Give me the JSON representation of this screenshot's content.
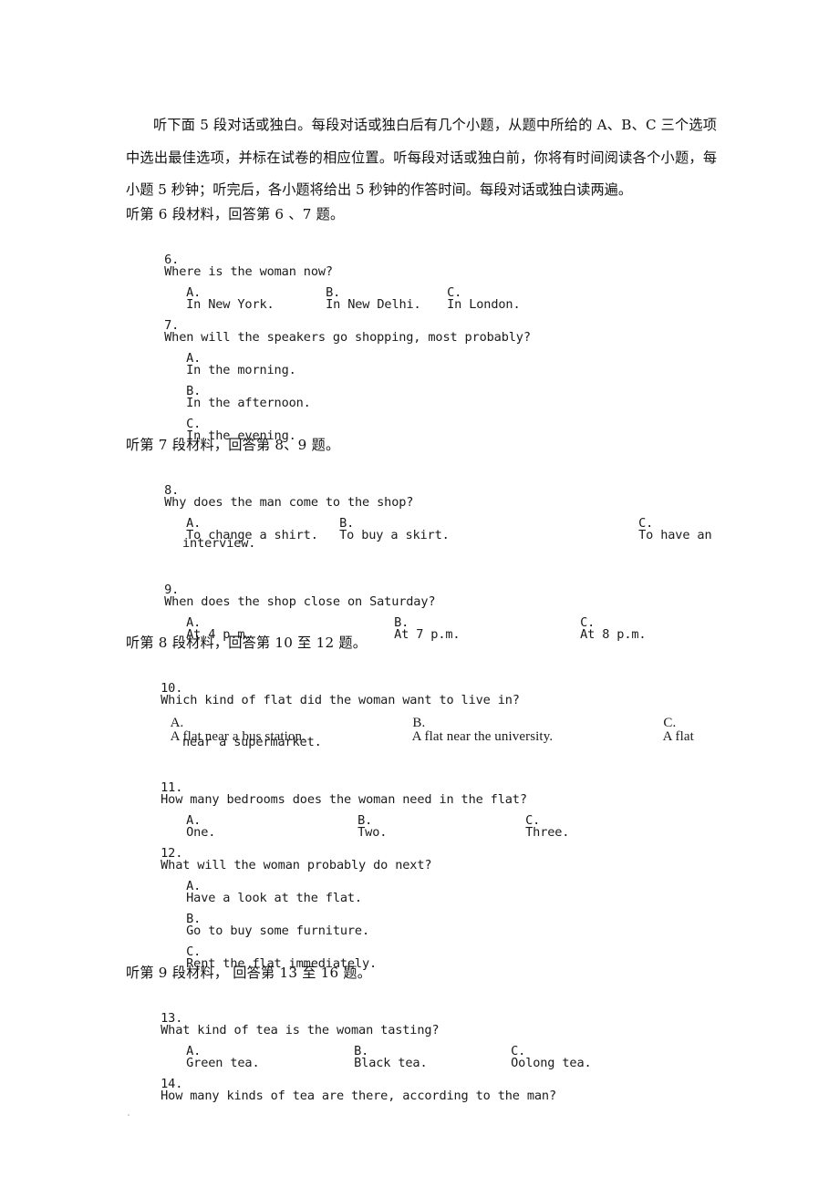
{
  "document": {
    "type": "exam-paper-listening-section",
    "language_note": "Chinese-English bilingual English listening comprehension exam page",
    "intro_paragraph": "听下面 5 段对话或独白。每段对话或独白后有几个小题，从题中所给的 A、B、C 三个选项中选出最佳选项，并标在试卷的相应位置。听每段对话或独白前，你将有时间阅读各个小题，每小题 5 秒钟；听完后，各小题将给出 5 秒钟的作答时间。每段对话或独白读两遍。"
  },
  "sections": [
    {
      "heading": "听第 6 段材料，回答第 6 、7 题。",
      "questions": [
        {
          "number": "6.",
          "stem": "Where is the woman now?",
          "layout": "inline",
          "options": [
            {
              "label": "A.",
              "text": "In New York."
            },
            {
              "label": "B.",
              "text": "In New Delhi."
            },
            {
              "label": "C.",
              "text": "In London."
            }
          ]
        },
        {
          "number": "7.",
          "stem": "When will the speakers go shopping, most probably?",
          "layout": "stacked",
          "options": [
            {
              "label": "A.",
              "text": "In the morning."
            },
            {
              "label": "B.",
              "text": "In the afternoon."
            },
            {
              "label": "C.",
              "text": "In the evening."
            }
          ]
        }
      ]
    },
    {
      "heading": "听第 7 段材料，回答第 8、9 题。",
      "questions": [
        {
          "number": "8.",
          "stem": "Why does the man come to the shop?",
          "layout": "inline-wrap",
          "options": [
            {
              "label": "A.",
              "text": "To change a shirt."
            },
            {
              "label": "B.",
              "text": "To buy a skirt."
            },
            {
              "label": "C.",
              "text": "To have an"
            }
          ],
          "wrap_line": "interview."
        },
        {
          "number": "9.",
          "stem": "When does the shop close on Saturday?",
          "layout": "inline",
          "options": [
            {
              "label": "A.",
              "text": "At 4 p.m."
            },
            {
              "label": "B.",
              "text": "At 7 p.m."
            },
            {
              "label": "C.",
              "text": "At 8 p.m."
            }
          ]
        }
      ]
    },
    {
      "heading": "听第 8 段材料，回答第 10 至 12 题。",
      "questions": [
        {
          "number": "10.",
          "stem": "Which kind of flat did the woman want to live in?",
          "layout": "inline-wrap",
          "options": [
            {
              "label": "A.",
              "text": "A flat near a bus station."
            },
            {
              "label": "B.",
              "text": "A flat near the university."
            },
            {
              "label": "C.",
              "text": "A flat"
            }
          ],
          "wrap_line": "near a supermarket."
        },
        {
          "number": "11.",
          "stem": "How many bedrooms does the woman need in the flat?",
          "layout": "inline",
          "options": [
            {
              "label": "A.",
              "text": "One."
            },
            {
              "label": "B.",
              "text": "Two."
            },
            {
              "label": "C.",
              "text": "Three."
            }
          ]
        },
        {
          "number": "12.",
          "stem": "What will the woman probably do next?",
          "layout": "stacked",
          "options": [
            {
              "label": "A.",
              "text": "Have a look at the flat."
            },
            {
              "label": "B.",
              "text": "Go to buy some furniture."
            },
            {
              "label": "C.",
              "text": "Rent the flat immediately."
            }
          ]
        }
      ]
    },
    {
      "heading": "听第 9 段材料， 回答第 13 至 16 题。",
      "questions": [
        {
          "number": "13.",
          "stem": "What kind of tea is the woman tasting?",
          "layout": "inline",
          "options": [
            {
              "label": "A.",
              "text": "Green tea."
            },
            {
              "label": "B.",
              "text": "Black tea."
            },
            {
              "label": "C.",
              "text": "Oolong tea."
            }
          ]
        },
        {
          "number": "14.",
          "stem": "How many kinds of tea are there, according to the man?",
          "layout": "stem-only",
          "options": []
        }
      ]
    }
  ],
  "colors": {
    "page_background": "#ffffff",
    "body_text": "#1a1a1a",
    "cjk_text": "#111111"
  }
}
